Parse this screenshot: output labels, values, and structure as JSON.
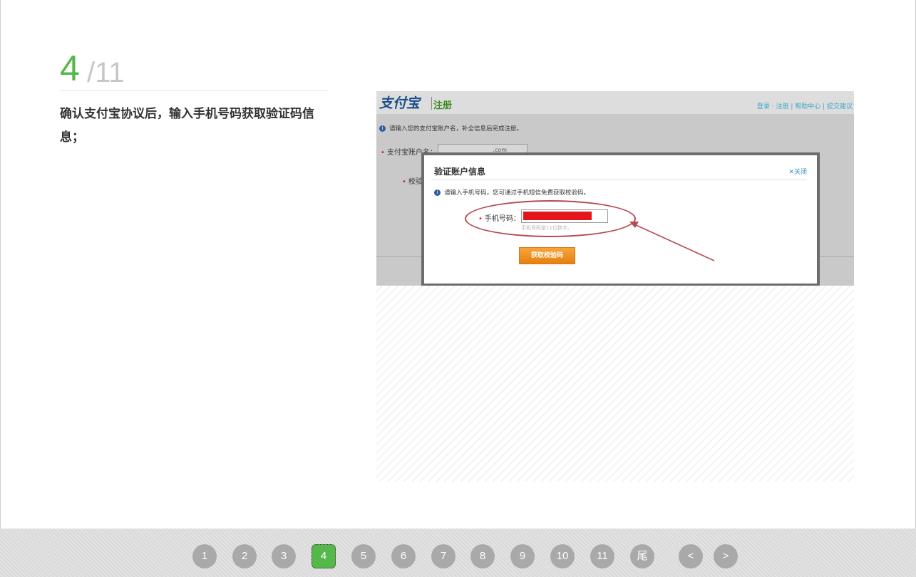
{
  "step": {
    "current": "4",
    "total": "/11"
  },
  "description": "确认支付宝协议后，输入手机号码获取验证码信息；",
  "screenshot": {
    "logo": "支付宝",
    "register_label": "注册",
    "top_links": "登录 · 注册 | 帮助中心 | 提交建议",
    "hint": "请输入您的支付宝账户名，补全信息后完成注册。",
    "account_label": "支付宝账户名：",
    "account_suffix": ".com",
    "verify_label": "校验",
    "modal": {
      "title": "验证账户信息",
      "close": "关闭",
      "hint": "请输入手机号码，您可通过手机短信免费获取校验码。",
      "phone_label": "手机号码：",
      "phone_sub": "手机号码是11位数字。",
      "get_code_button": "获取校验码"
    }
  },
  "pagination": {
    "pages": [
      "1",
      "2",
      "3",
      "4",
      "5",
      "6",
      "7",
      "8",
      "9",
      "10",
      "11",
      "尾"
    ],
    "active": "4",
    "prev": "<",
    "next": ">"
  }
}
